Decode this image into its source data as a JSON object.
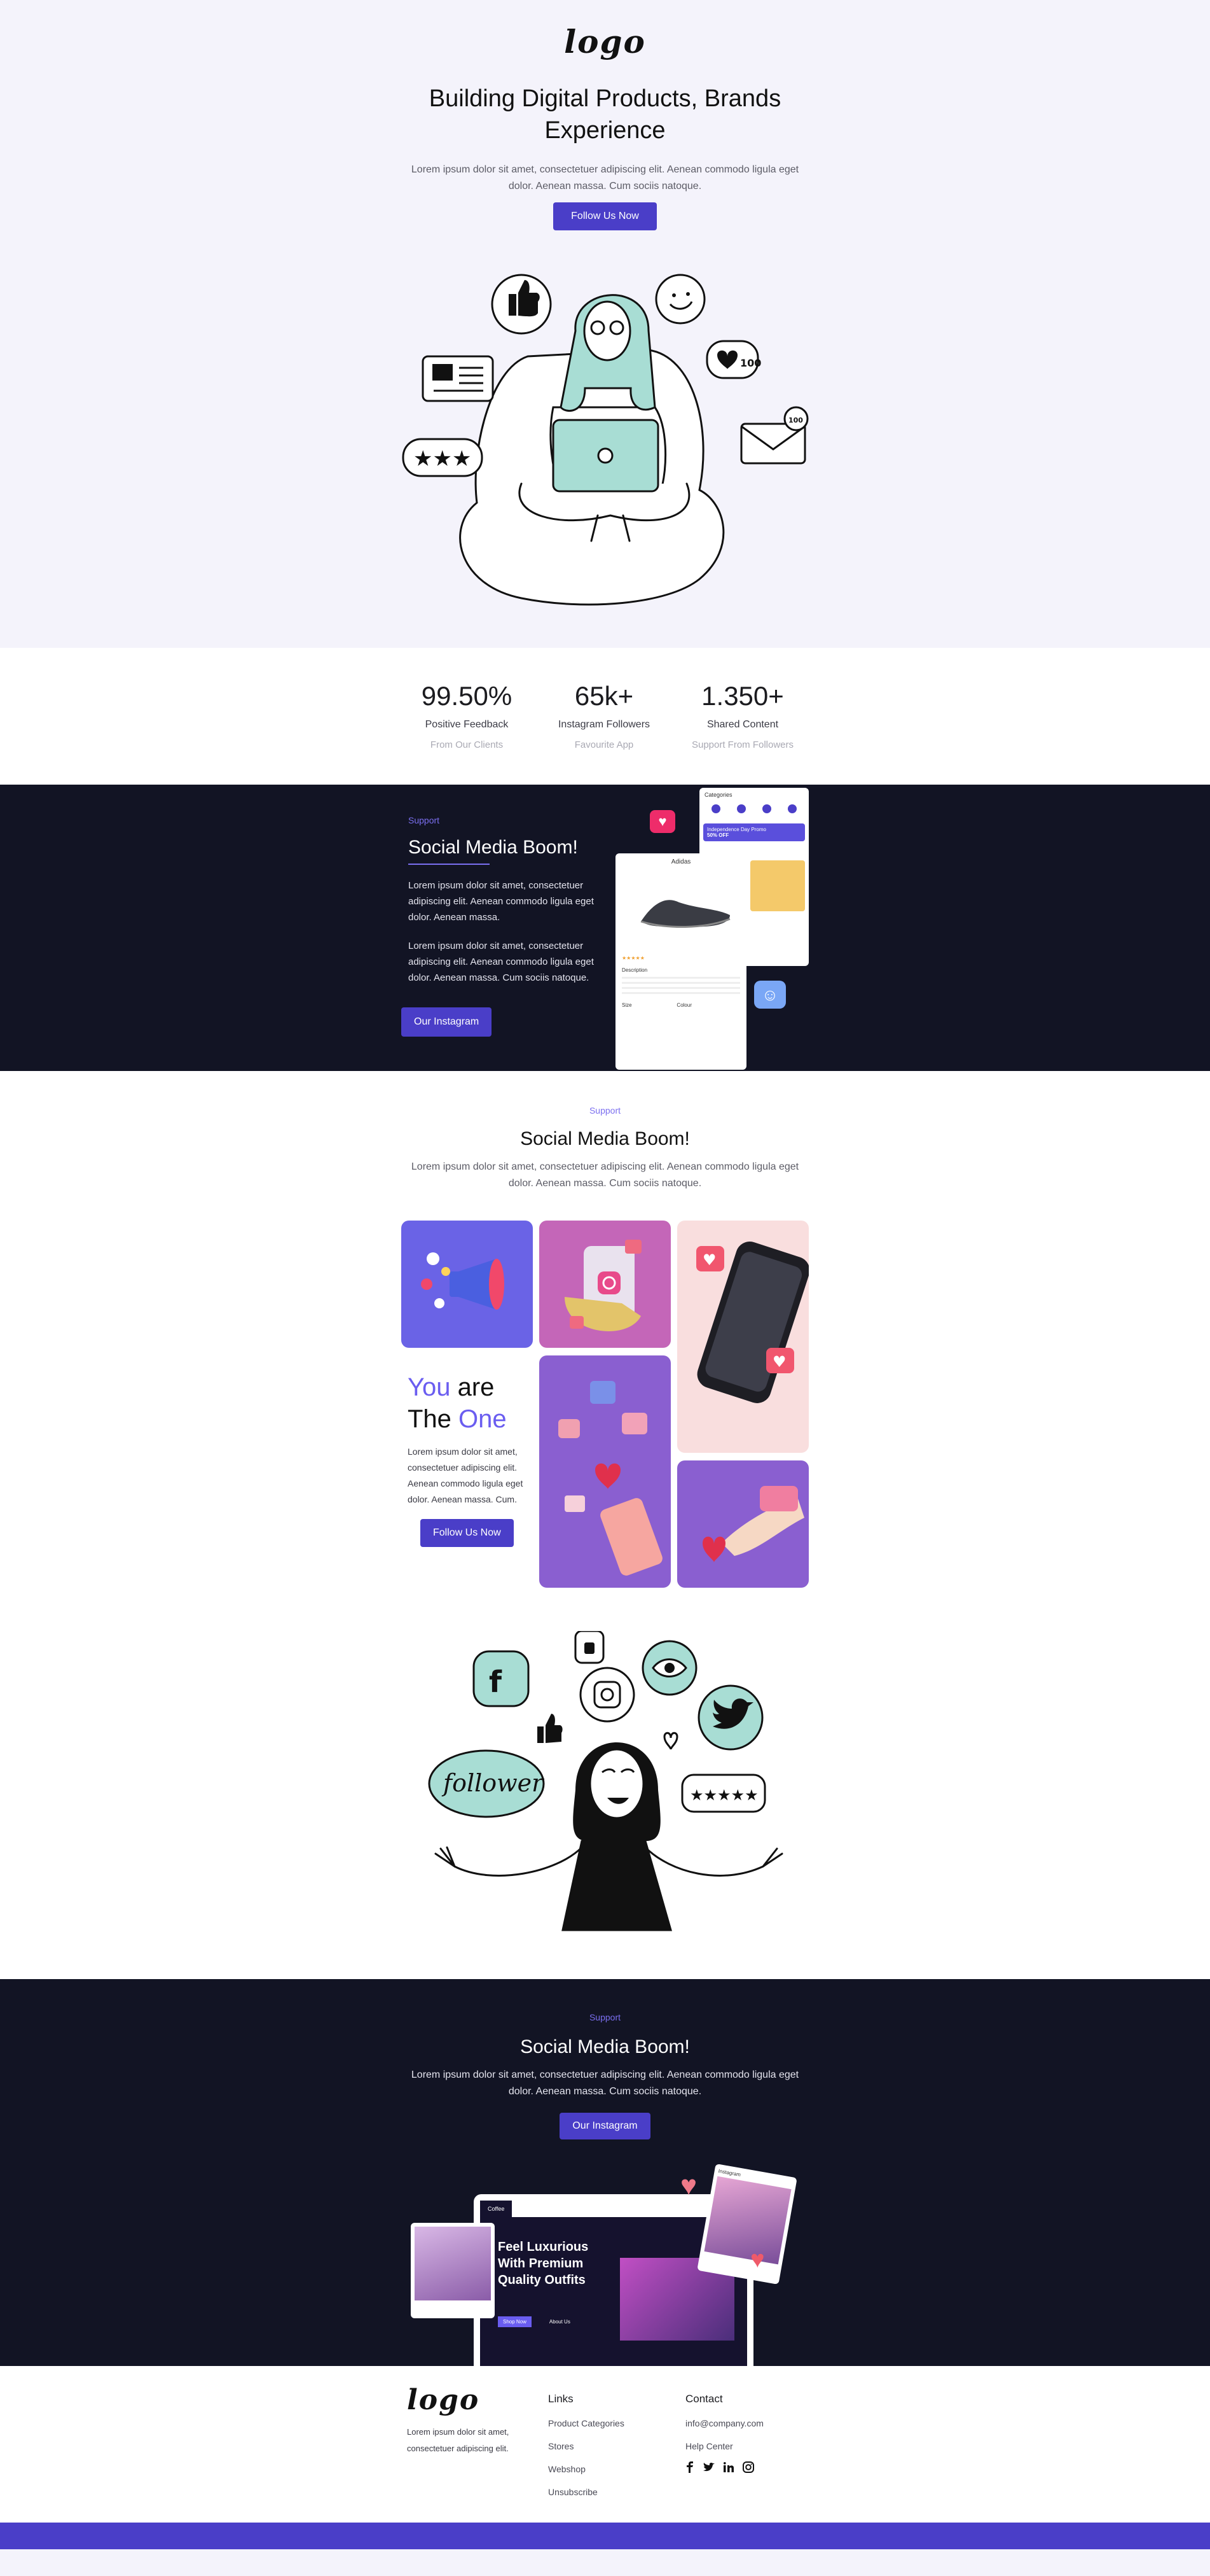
{
  "hero": {
    "logo": "logo",
    "title_line1": "Building Digital Products, Brands",
    "title_line2": "Experience",
    "desc_line1": "Lorem ipsum dolor sit amet, consectetuer adipiscing elit. Aenean commodo ligula eget",
    "desc_line2": "dolor. Aenean massa. Cum sociis natoque.",
    "button": "Follow Us Now",
    "bubble_likes": "100",
    "bubble_mail": "100"
  },
  "stats": [
    {
      "value": "99.50%",
      "label": "Positive Feedback",
      "sub": "From Our Clients"
    },
    {
      "value": "65k+",
      "label": "Instagram Followers",
      "sub": "Favourite App"
    },
    {
      "value": "1.350+",
      "label": "Shared Content",
      "sub": "Support From Followers"
    }
  ],
  "support1": {
    "label": "Support",
    "title": "Social Media Boom!",
    "para1_l1": "Lorem ipsum dolor sit amet, consectetuer",
    "para1_l2": "adipiscing elit. Aenean commodo ligula eget",
    "para1_l3": "dolor. Aenean massa.",
    "para2_l1": "Lorem ipsum dolor sit amet, consectetuer",
    "para2_l2": "adipiscing elit. Aenean commodo ligula eget",
    "para2_l3": "dolor. Aenean massa. Cum sociis natoque.",
    "button": "Our Instagram",
    "phone_header": "Categories",
    "phone_promo_l1": "Independence Day Promo",
    "phone_promo_l2": "50% OFF",
    "phone_product": "Adidas",
    "phone_desc": "Description",
    "phone_size": "Size",
    "phone_color": "Colour"
  },
  "support2": {
    "label": "Support",
    "title": "Social Media Boom!",
    "desc_line1": "Lorem ipsum dolor sit amet, consectetuer adipiscing elit. Aenean commodo ligula eget",
    "desc_line2": "dolor. Aenean massa. Cum sociis natoque.",
    "you": "You",
    "are": " are",
    "the": "The ",
    "one": "One",
    "text_l1": "Lorem ipsum dolor sit amet,",
    "text_l2": "consectetuer adipiscing elit.",
    "text_l3": "Aenean commodo ligula eget",
    "text_l4": "dolor. Aenean massa. Cum.",
    "button": "Follow Us Now",
    "bubble_word": "follower"
  },
  "support3": {
    "label": "Support",
    "title": "Social Media Boom!",
    "desc_line1": "Lorem ipsum dolor sit amet, consectetuer adipiscing elit. Aenean commodo ligula eget",
    "desc_line2": "dolor. Aenean massa. Cum sociis natoque.",
    "button": "Our Instagram",
    "laptop_brand": "Coffee",
    "laptop_heading_l1": "Feel Luxurious",
    "laptop_heading_l2": "With Premium",
    "laptop_heading_l3": "Quality  Outfits",
    "laptop_btn1": "Shop Now",
    "laptop_btn2": "About Us",
    "card_title": "Instagram"
  },
  "footer": {
    "logo": "logo",
    "text_l1": "Lorem ipsum dolor sit amet,",
    "text_l2": "consectetuer adipiscing elit.",
    "links_title": "Links",
    "links": [
      "Product Categories",
      "Stores",
      "Webshop",
      "Unsubscribe"
    ],
    "contact_title": "Contact",
    "contact": [
      "info@company.com",
      "Help Center"
    ],
    "social_icons": [
      "facebook-icon",
      "twitter-icon",
      "linkedin-icon",
      "instagram-icon"
    ]
  },
  "colors": {
    "accent": "#4a3ec8",
    "accent_light": "#7b6ff0",
    "dark": "#121424",
    "mint": "#a8ddd4"
  }
}
